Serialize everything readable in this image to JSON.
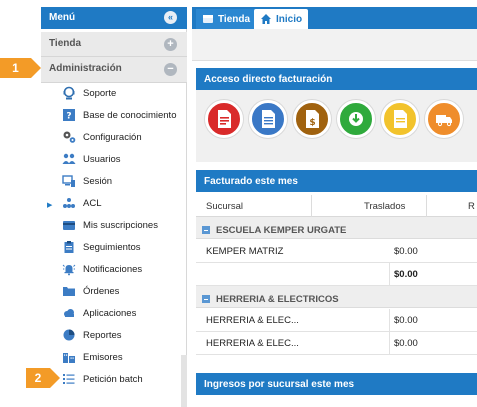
{
  "sidebar": {
    "title": "Menú",
    "sections": [
      {
        "label": "Tienda"
      },
      {
        "label": "Administración"
      }
    ],
    "items": [
      {
        "label": "Soporte",
        "icon": "support-icon"
      },
      {
        "label": "Base de conocimiento",
        "icon": "knowledge-base-icon"
      },
      {
        "label": "Configuración",
        "icon": "gears-icon"
      },
      {
        "label": "Usuarios",
        "icon": "users-icon"
      },
      {
        "label": "Sesión",
        "icon": "session-icon"
      },
      {
        "label": "ACL",
        "icon": "acl-icon"
      },
      {
        "label": "Mis suscripciones",
        "icon": "card-icon"
      },
      {
        "label": "Seguimientos",
        "icon": "clipboard-icon"
      },
      {
        "label": "Notificaciones",
        "icon": "bell-icon"
      },
      {
        "label": "Órdenes",
        "icon": "folder-icon"
      },
      {
        "label": "Aplicaciones",
        "icon": "cloud-icon"
      },
      {
        "label": "Reportes",
        "icon": "pie-chart-icon"
      },
      {
        "label": "Emisores",
        "icon": "buildings-icon"
      },
      {
        "label": "Petición batch",
        "icon": "list-icon"
      }
    ]
  },
  "callouts": [
    "1",
    "2"
  ],
  "tabs": [
    {
      "label": "Tienda",
      "icon": "store-icon"
    },
    {
      "label": "Inicio",
      "icon": "home-icon"
    }
  ],
  "panels": {
    "quick_access": "Acceso directo facturación",
    "billed": "Facturado este mes",
    "income": "Ingresos por sucursal este mes"
  },
  "table": {
    "headers": [
      "Sucursal",
      "Traslados",
      "R"
    ],
    "groups": [
      {
        "name": "ESCUELA KEMPER URGATE",
        "rows": [
          {
            "sucursal": "KEMPER MATRIZ",
            "traslados": "$0.00"
          },
          {
            "sucursal": "",
            "traslados": "$0.00"
          }
        ]
      },
      {
        "name": "HERRERIA & ELECTRICOS",
        "rows": [
          {
            "sucursal": "HERRERIA & ELEC...",
            "traslados": "$0.00"
          },
          {
            "sucursal": "HERRERIA & ELEC...",
            "traslados": "$0.00"
          }
        ]
      }
    ]
  },
  "colors": {
    "primary": "#1f7ac4",
    "callout": "#f39b27",
    "btn_red": "#d92a2a",
    "btn_blue": "#3a78c6",
    "btn_brown": "#a0620f",
    "btn_green": "#2faa3c",
    "btn_yellow": "#f2c32c",
    "btn_orange": "#ef8d2b"
  }
}
